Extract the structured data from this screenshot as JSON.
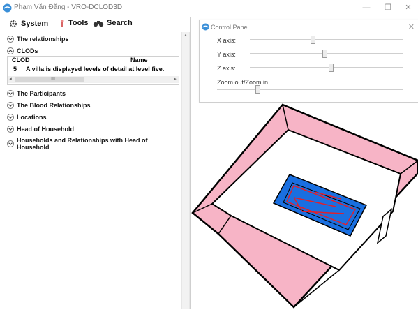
{
  "window": {
    "title": "Phạm Văn Đăng - VRO-DCLOD3D",
    "minimize": "—",
    "maximize": "❐",
    "close": "✕"
  },
  "menu": {
    "system": "System",
    "tools": "Tools",
    "search": "Search"
  },
  "tree": {
    "relationships": "The relationships",
    "clods": "CLODs",
    "participants": "The Participants",
    "blood": "The Blood Relationships",
    "locations": "Locations",
    "head": "Head of Household",
    "households": "Households and Relationships with Head of Household"
  },
  "clod_table": {
    "headers": [
      "CLOD",
      "Name"
    ],
    "rows": [
      [
        "5",
        "A villa is displayed levels of detail at level five."
      ]
    ],
    "scroll_left": "◂",
    "scroll_mid": "III",
    "scroll_right": "▸"
  },
  "control_panel": {
    "title": "Control Panel",
    "close": "✕",
    "x_label": "X axis:",
    "y_label": "Y axis:",
    "z_label": "Z axis:",
    "zoom_label": "Zoom out/Zoom in",
    "x_value": 0.41,
    "y_value": 0.49,
    "z_value": 0.53,
    "zoom_value": 0.21
  },
  "colors": {
    "wall_fill": "#f7b4c6",
    "inner_fill": "#1a6fe0",
    "red_outline": "#e0202c"
  }
}
